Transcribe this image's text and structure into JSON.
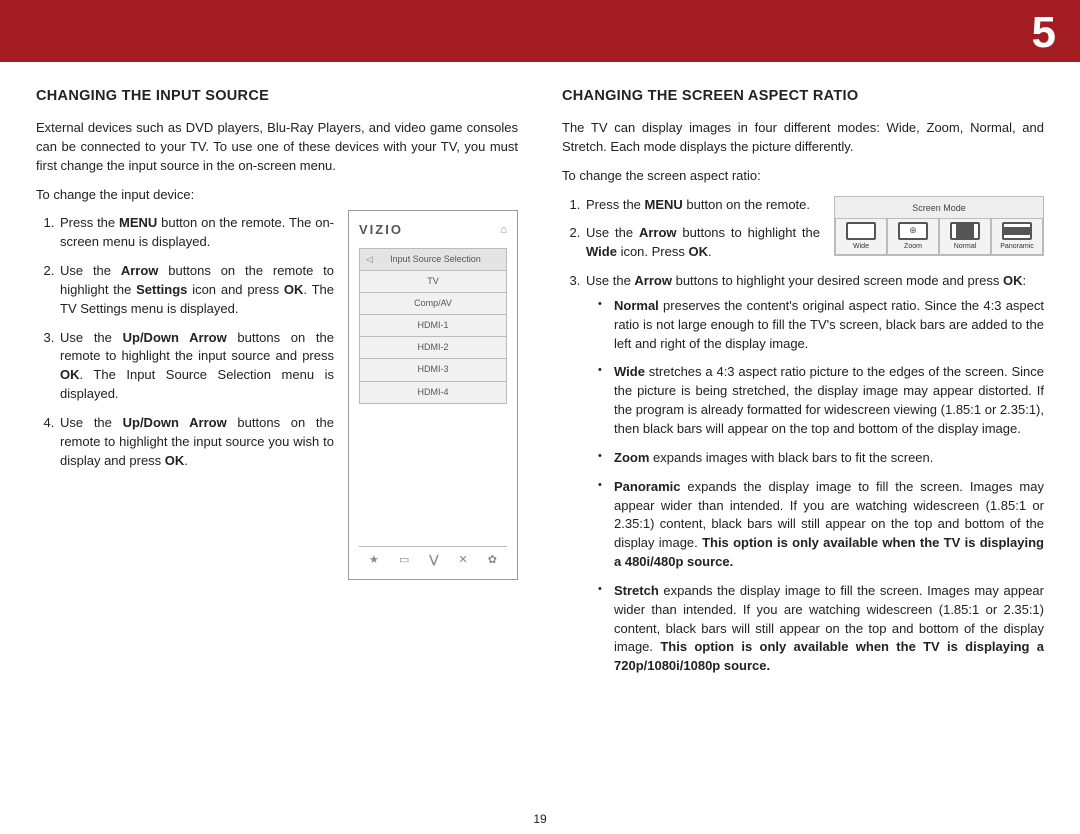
{
  "chapter": "5",
  "pageNumber": "19",
  "left": {
    "heading": "CHANGING THE INPUT SOURCE",
    "intro": "External devices such as DVD players, Blu-Ray Players, and video game consoles can be connected to your TV. To use one of these devices with your TV, you must first change the input source in the on-screen menu.",
    "lead": "To change the input device:",
    "steps": {
      "s1a": "Press the ",
      "s1b": "MENU",
      "s1c": " button on the remote. The on-screen menu is displayed.",
      "s2a": "Use the ",
      "s2b": "Arrow",
      "s2c": " buttons on the remote to highlight the ",
      "s2d": "Settings",
      "s2e": " icon and press ",
      "s2f": "OK",
      "s2g": ". The TV Settings menu is displayed.",
      "s3a": "Use the ",
      "s3b": "Up/Down Arrow",
      "s3c": " buttons on the remote to highlight the input source and press ",
      "s3d": "OK",
      "s3e": ". The Input Source Selection menu is displayed.",
      "s4a": "Use the ",
      "s4b": "Up/Down Arrow",
      "s4c": " buttons on the remote to highlight the input source you wish to display and press ",
      "s4d": "OK",
      "s4e": "."
    },
    "vizio": {
      "logo": "VIZIO",
      "menuTitle": "Input Source Selection",
      "items": [
        "TV",
        "Comp/AV",
        "HDMI-1",
        "HDMI-2",
        "HDMI-3",
        "HDMI-4"
      ]
    }
  },
  "right": {
    "heading": "CHANGING THE SCREEN ASPECT RATIO",
    "intro": "The TV can display images in four different modes: Wide, Zoom, Normal, and Stretch. Each mode displays the picture differently.",
    "lead": "To change the screen aspect ratio:",
    "s1a": "Press the ",
    "s1b": "MENU",
    "s1c": " button on the remote.",
    "s2a": "Use the ",
    "s2b": "Arrow",
    "s2c": " buttons to highlight the ",
    "s2d": "Wide",
    "s2e": " icon. Press ",
    "s2f": "OK",
    "s2g": ".",
    "s3a": "Use the ",
    "s3b": "Arrow",
    "s3c": " buttons to highlight your desired screen mode and press ",
    "s3d": "OK",
    "s3e": ":",
    "modes": {
      "normal_b": "Normal",
      "normal_t": " preserves the content's original aspect ratio. Since the 4:3 aspect ratio is not large enough to fill the TV's screen, black bars are added to the left and right of the display image.",
      "wide_b": "Wide",
      "wide_t": " stretches a 4:3 aspect ratio picture to the edges of the screen. Since the picture is being stretched, the display image may appear distorted. If the program is already formatted for widescreen viewing (1.85:1 or 2.35:1), then black bars will appear on the top and bottom of the display image.",
      "zoom_b": "Zoom",
      "zoom_t": " expands images with black bars to fit the screen.",
      "pano_b": "Panoramic",
      "pano_t1": " expands the display image to fill the screen. Images may appear wider than intended. If you are watching widescreen (1.85:1 or 2.35:1) content, black bars will still appear on the top and bottom of the display image. ",
      "pano_t2": "This option is only available when the TV is displaying a 480i/480p source.",
      "stretch_b": "Stretch",
      "stretch_t1": " expands the display image to fill the screen. Images may appear wider than intended. If you are watching widescreen (1.85:1 or 2.35:1) content, black bars will still appear on the top and bottom of the display image. ",
      "stretch_t2": "This option is only available when the TV is displaying a 720p/1080i/1080p source."
    },
    "screenModeBox": {
      "title": "Screen Mode",
      "labels": [
        "Wide",
        "Zoom",
        "Normal",
        "Panoramic"
      ]
    }
  }
}
